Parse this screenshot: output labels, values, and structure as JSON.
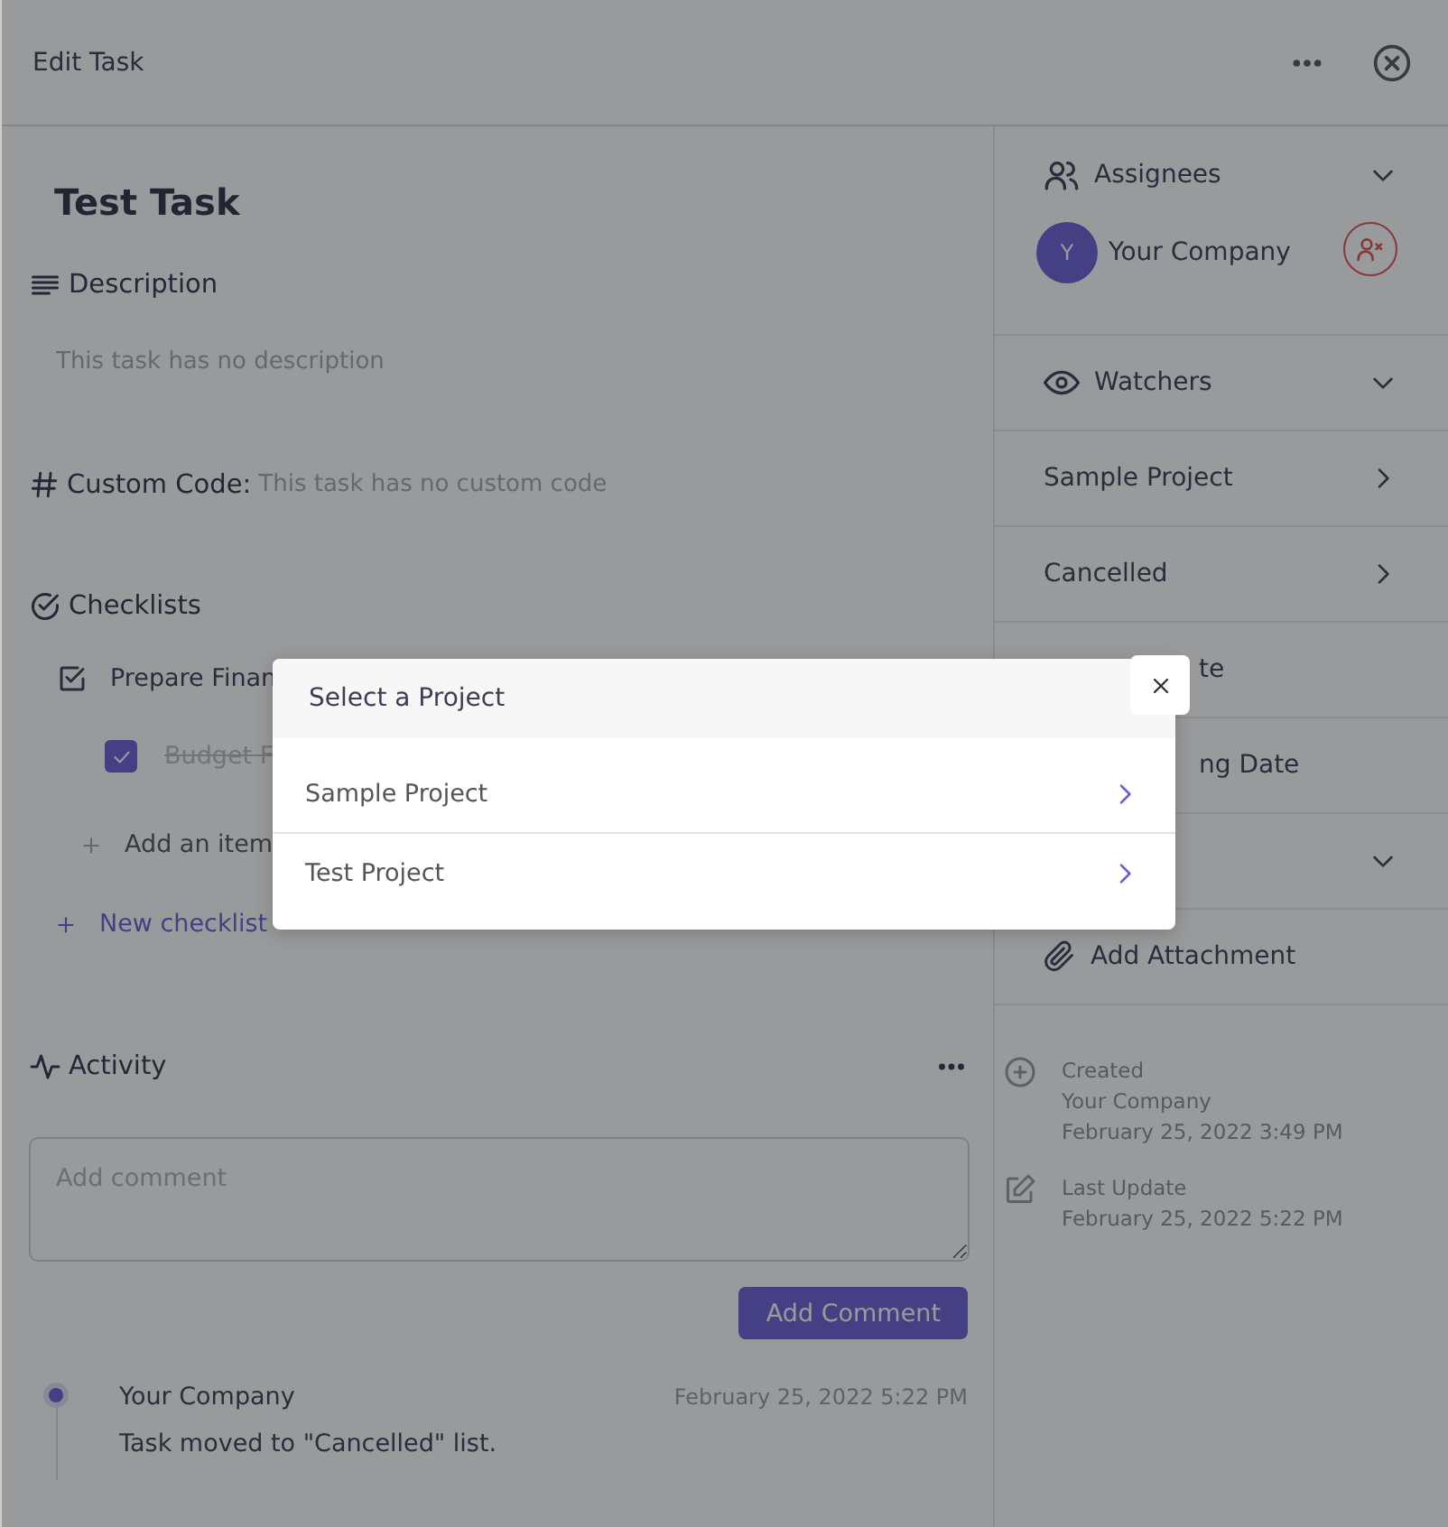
{
  "window": {
    "title": "Edit Task"
  },
  "task": {
    "title": "Test Task",
    "description": {
      "heading": "Description",
      "placeholder": "This task has no description"
    },
    "custom_code": {
      "label": "Custom Code:",
      "value": "This task has no custom code"
    },
    "checklists": {
      "heading": "Checklists",
      "lists": [
        {
          "title": "Prepare Finan",
          "items": [
            {
              "text": "Budget F",
              "checked": true
            }
          ],
          "add_item": "Add an item"
        }
      ],
      "new_checklist": "New checklist"
    },
    "activity": {
      "heading": "Activity",
      "comment_placeholder": "Add comment",
      "submit": "Add Comment",
      "entries": [
        {
          "author": "Your Company",
          "time": "February 25, 2022 5:22 PM",
          "text": "Task moved to \"Cancelled\" list."
        }
      ]
    }
  },
  "sidebar": {
    "assignees": {
      "label": "Assignees",
      "people": [
        {
          "initial": "Y",
          "name": "Your Company"
        }
      ]
    },
    "watchers": {
      "label": "Watchers"
    },
    "rows": [
      {
        "kind": "link",
        "label": "Sample Project"
      },
      {
        "kind": "link",
        "label": "Cancelled"
      },
      {
        "kind": "partial",
        "label": "te"
      },
      {
        "kind": "partial",
        "label": "ng Date"
      },
      {
        "kind": "dropdown"
      },
      {
        "kind": "attachment",
        "label": "Add Attachment"
      }
    ],
    "meta": [
      {
        "kind": "created",
        "label": "Created",
        "lines": [
          "Your Company",
          "February 25, 2022 3:49 PM"
        ]
      },
      {
        "kind": "updated",
        "label": "Last Update",
        "lines": [
          "February 25, 2022 5:22 PM"
        ]
      }
    ]
  },
  "modal": {
    "title": "Select a Project",
    "options": [
      {
        "label": "Sample Project"
      },
      {
        "label": "Test Project"
      }
    ]
  }
}
